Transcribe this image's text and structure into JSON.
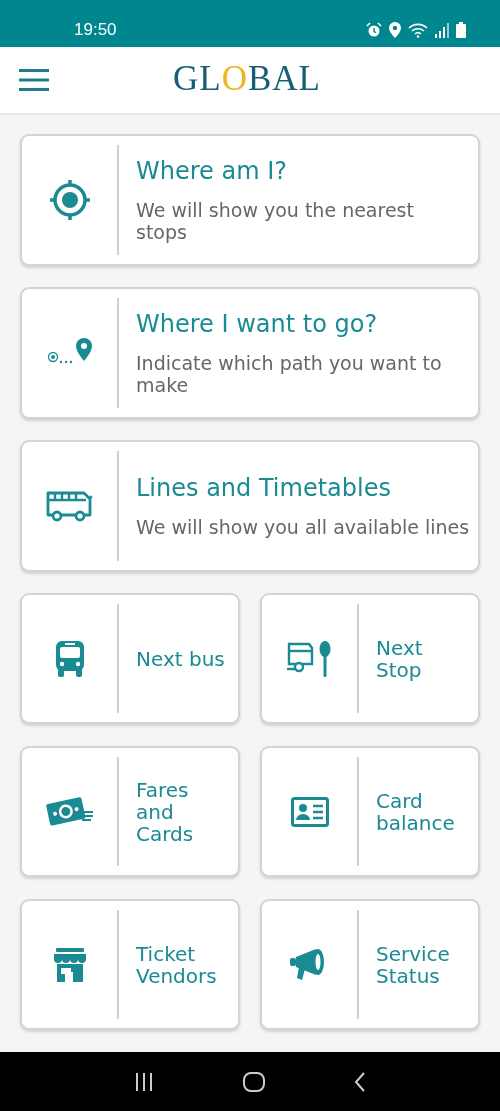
{
  "status_bar": {
    "time": "19:50"
  },
  "header": {
    "logo": "GLOBAL"
  },
  "large_cards": [
    {
      "title": "Where am I?",
      "subtitle": "We will show you the nearest stops"
    },
    {
      "title": "Where I want to go?",
      "subtitle": "Indicate which path you want to make"
    },
    {
      "title": "Lines and Timetables",
      "subtitle": "We will show you all available lines"
    }
  ],
  "tiles": [
    {
      "label": "Next bus"
    },
    {
      "label": "Next Stop"
    },
    {
      "label": "Fares and Cards"
    },
    {
      "label": "Card balance"
    },
    {
      "label": "Ticket Vendors"
    },
    {
      "label": "Service Status"
    }
  ]
}
